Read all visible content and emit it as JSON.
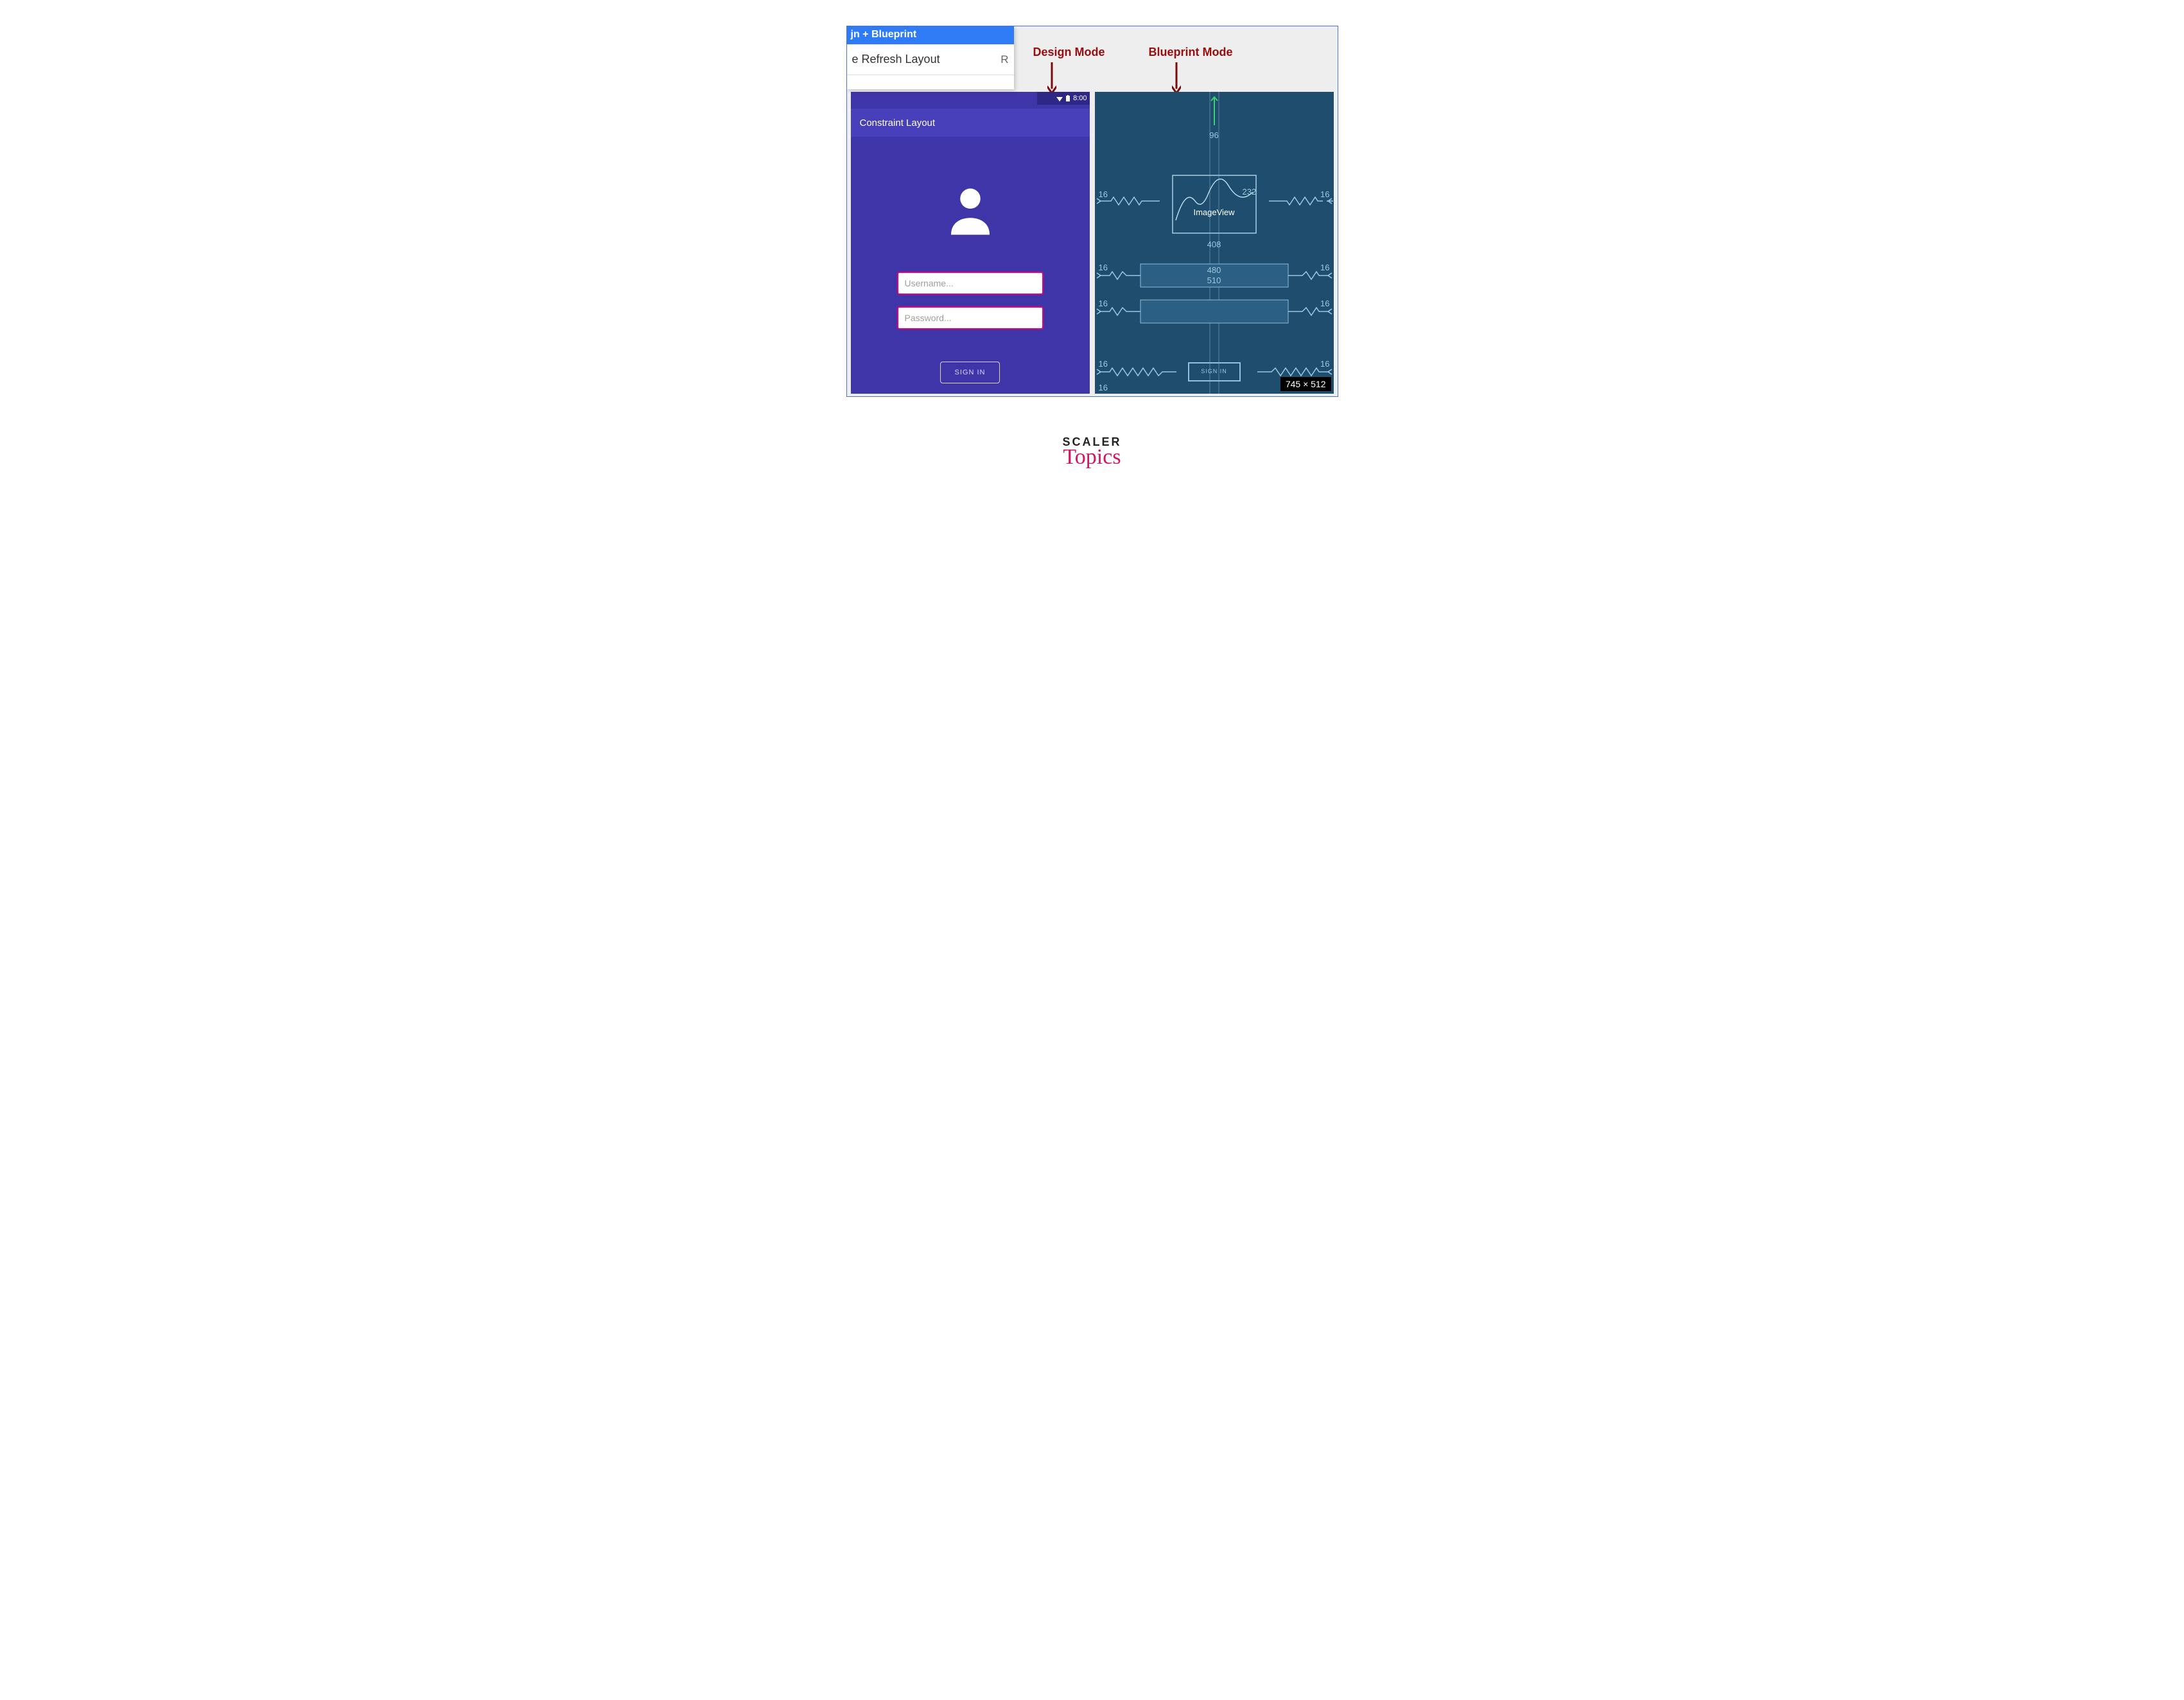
{
  "menu": {
    "title_fragment": "jn + Blueprint",
    "refresh_label_fragment": "e Refresh Layout",
    "refresh_shortcut": "R"
  },
  "labels": {
    "design_mode": "Design Mode",
    "blueprint_mode": "Blueprint Mode"
  },
  "status": {
    "time": "8:00"
  },
  "appbar": {
    "title": "Constraint Layout"
  },
  "fields": {
    "username_placeholder": "Username...",
    "password_placeholder": "Password..."
  },
  "buttons": {
    "signin": "SIGN IN"
  },
  "blueprint": {
    "top_margin": "96",
    "imageview_label": "ImageView",
    "imageview_right_dim": "232",
    "below_image": "408",
    "row1_top": "480",
    "row1_bottom": "510",
    "side_16": "16",
    "signin_text": "SIGN IN",
    "bottom_16": "16",
    "size_badge": "745 × 512"
  },
  "watermark": {
    "scaler": "SCALER",
    "topics": "Topics"
  }
}
